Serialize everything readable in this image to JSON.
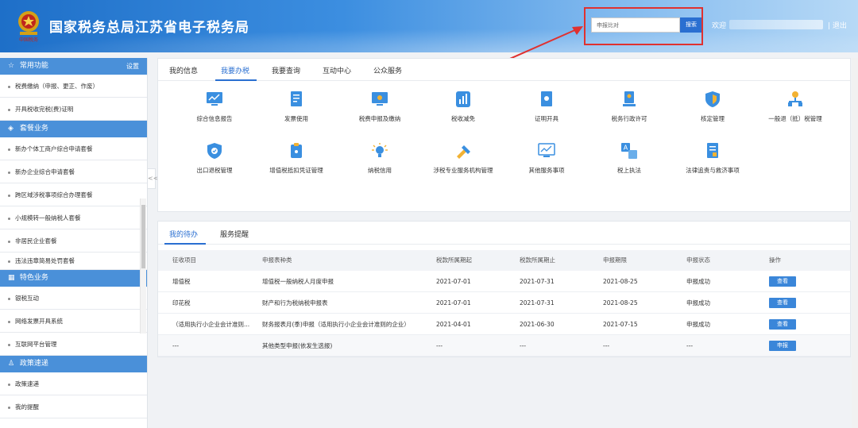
{
  "header": {
    "title": "国家税务总局江苏省电子税务局",
    "emblem_caption": "中国税务",
    "search_value": "申报比对",
    "search_button": "搜索",
    "welcome": "欢迎",
    "logout": "| 退出",
    "colors": {
      "bar": "#1e6fc8",
      "highlight_frame": "#e0312f"
    }
  },
  "sidebar": {
    "sections": [
      {
        "title": "常用功能",
        "icon": "star-icon",
        "extra": "设置",
        "items": [
          "税费缴纳（申报、更正、作废）",
          "开具税收完税(费)证明"
        ]
      },
      {
        "title": "套餐业务",
        "icon": "layers-icon",
        "items": [
          "新办个体工商户综合申请套餐",
          "新办企业综合申请套餐",
          "跨区域涉税事项综合办理套餐",
          "小规模转一般纳税人套餐",
          "非居民企业套餐",
          "违法违章简易处罚套餐"
        ]
      },
      {
        "title": "特色业务",
        "icon": "grid-icon",
        "items": [
          "银税互动",
          "网络发票开具系统",
          "互联网平台管理"
        ]
      },
      {
        "title": "政策速递",
        "icon": "person-icon",
        "items": [
          "政策速递",
          "我的提醒"
        ]
      }
    ],
    "collapse_glyph": "<<"
  },
  "main": {
    "tabs": [
      "我的信息",
      "我要办税",
      "我要查询",
      "互动中心",
      "公众服务"
    ],
    "active_tab": "我要办税",
    "functions_row1": [
      {
        "label": "综合信息报告",
        "icon": "report-chart-icon"
      },
      {
        "label": "发票使用",
        "icon": "invoice-icon"
      },
      {
        "label": "税费申报及缴纳",
        "icon": "monitor-icon"
      },
      {
        "label": "税收减免",
        "icon": "bar-chart-icon"
      },
      {
        "label": "证明开具",
        "icon": "certificate-icon"
      },
      {
        "label": "税务行政许可",
        "icon": "license-icon"
      },
      {
        "label": "核定管理",
        "icon": "shield-icon"
      },
      {
        "label": "一般退（抵）税管理",
        "icon": "org-chart-icon"
      }
    ],
    "functions_row2": [
      {
        "label": "出口退税管理",
        "icon": "shield-check-icon"
      },
      {
        "label": "增值税抵扣凭证管理",
        "icon": "document-lock-icon"
      },
      {
        "label": "纳税信用",
        "icon": "bulb-icon"
      },
      {
        "label": "涉税专业服务机构管理",
        "icon": "tools-icon"
      },
      {
        "label": "其他服务事项",
        "icon": "trend-monitor-icon"
      },
      {
        "label": "税上执法",
        "icon": "translate-icon"
      },
      {
        "label": "法律追责与救济事项",
        "icon": "legal-doc-icon"
      }
    ]
  },
  "todo": {
    "tabs": [
      "我的待办",
      "服务提醒"
    ],
    "active_tab": "我的待办",
    "columns": [
      "征收项目",
      "申报表种类",
      "税款所属期起",
      "税款所属期止",
      "申报期限",
      "申报状态",
      "操作"
    ],
    "rows": [
      {
        "item": "增值税",
        "form": "增值税一般纳税人月度申报",
        "start": "2021-07-01",
        "end": "2021-07-31",
        "deadline": "2021-08-25",
        "status": "申报成功",
        "action": "查看"
      },
      {
        "item": "印花税",
        "form": "财产和行为税纳税申报表",
        "start": "2021-07-01",
        "end": "2021-07-31",
        "deadline": "2021-08-25",
        "status": "申报成功",
        "action": "查看"
      },
      {
        "item": "（适用执行小企业会计准则...",
        "form": "财务报表月(季)申报（适用执行小企业会计准则的企业）",
        "start": "2021-04-01",
        "end": "2021-06-30",
        "deadline": "2021-07-15",
        "status": "申报成功",
        "action": "查看"
      },
      {
        "item": "---",
        "form": "其他类型申报(依发生选报)",
        "start": "---",
        "end": "---",
        "deadline": "---",
        "status": "---",
        "action": "申报"
      }
    ]
  }
}
